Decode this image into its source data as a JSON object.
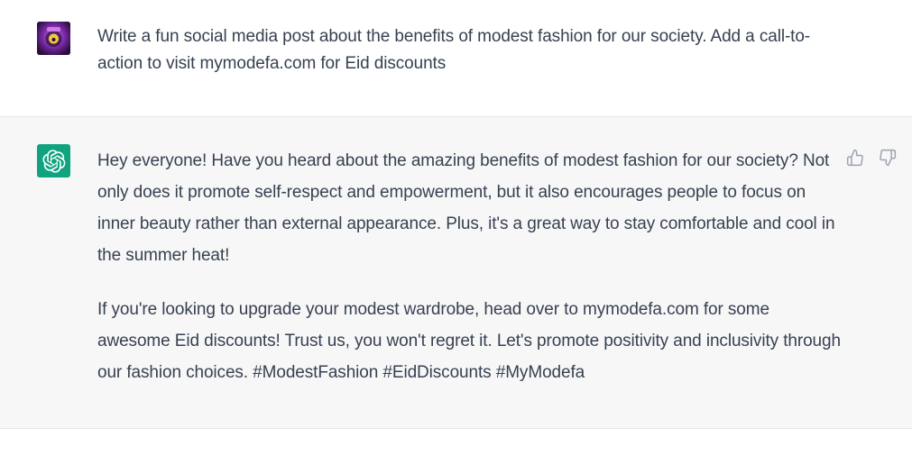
{
  "user_message": {
    "text": "Write a fun social media post about the benefits of modest fashion for our society. Add a call-to-action to visit mymodefa.com for Eid discounts",
    "avatar_icon": "user-avatar-purple"
  },
  "assistant_message": {
    "avatar_icon": "openai-logo-icon",
    "avatar_color": "#10a37f",
    "paragraphs": [
      "Hey everyone! Have you heard about the amazing benefits of modest fashion for our society? Not only does it promote self-respect and empowerment, but it also encourages people to focus on inner beauty rather than external appearance. Plus, it's a great way to stay comfortable and cool in the summer heat!",
      "If you're looking to upgrade your modest wardrobe, head over to mymodefa.com for some awesome Eid discounts! Trust us, you won't regret it. Let's promote positivity and inclusivity through our fashion choices. #ModestFashion #EidDiscounts #MyModefa"
    ],
    "feedback_icons": [
      "thumbs-up-icon",
      "thumbs-down-icon"
    ]
  }
}
